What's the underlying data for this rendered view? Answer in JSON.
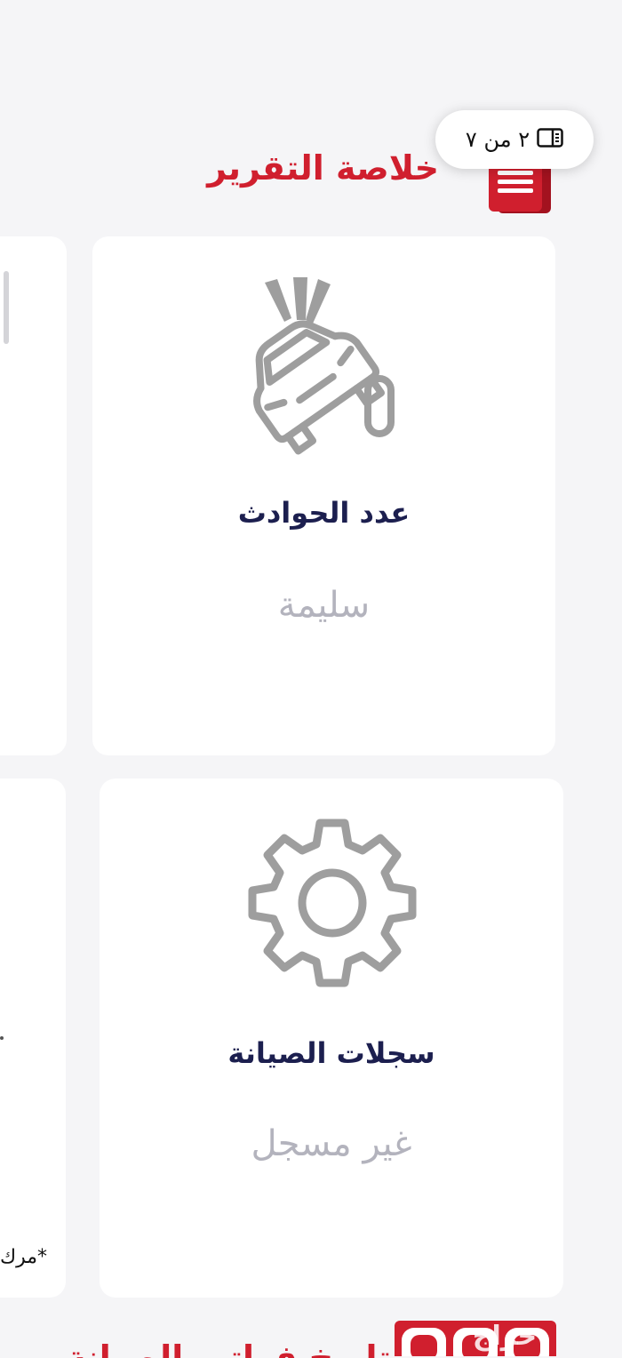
{
  "header": {
    "title": "خلاصة التقرير",
    "page_indicator": "٢ من ٧",
    "page_icon": "book-icon",
    "section_icon": "report-stack-icon"
  },
  "cards": [
    {
      "label": "عدد الحوادث",
      "value": "سليمة",
      "icon": "car-crash-icon"
    },
    {
      "label": "سجلات الصيانة",
      "value": "غير مسجل",
      "icon": "gear-icon"
    }
  ],
  "left_partial": {
    "note": "*مرك"
  },
  "bottom": {
    "title": "تاريخ فواتير الصيانة",
    "watermark": "حراج"
  },
  "colors": {
    "accent": "#d01f2e",
    "label": "#1c1f4f",
    "value": "#b3b3bd",
    "icon": "#9e9e9e",
    "background": "#f5f5f7"
  }
}
